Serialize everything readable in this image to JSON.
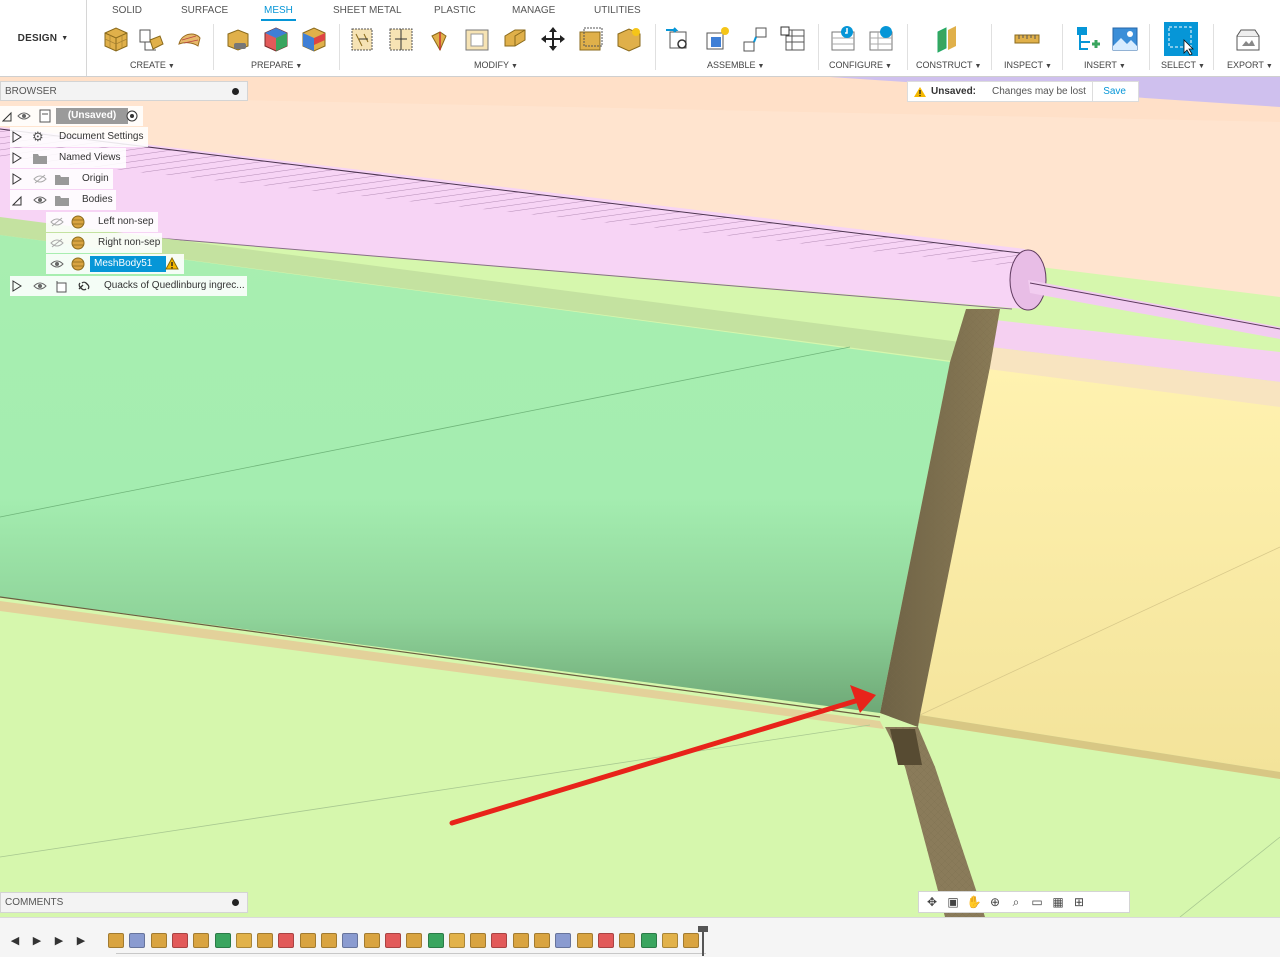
{
  "workspace": {
    "label": "DESIGN"
  },
  "tabs": [
    {
      "label": "SOLID"
    },
    {
      "label": "SURFACE"
    },
    {
      "label": "MESH",
      "active": true
    },
    {
      "label": "SHEET METAL"
    },
    {
      "label": "PLASTIC"
    },
    {
      "label": "MANAGE"
    },
    {
      "label": "UTILITIES"
    }
  ],
  "groups": {
    "create": "CREATE",
    "prepare": "PREPARE",
    "modify": "MODIFY",
    "assemble": "ASSEMBLE",
    "configure": "CONFIGURE",
    "construct": "CONSTRUCT",
    "inspect": "INSPECT",
    "insert": "INSERT",
    "select": "SELECT",
    "export": "EXPORT"
  },
  "browser": {
    "title": "BROWSER",
    "root": "(Unsaved)",
    "items": {
      "document_settings": "Document Settings",
      "named_views": "Named Views",
      "origin": "Origin",
      "bodies": "Bodies",
      "left_body": "Left non-sep",
      "right_body": "Right non-sep",
      "mesh_body": "MeshBody51",
      "linked": "Quacks of Quedlinburg ingrec..."
    }
  },
  "unsaved": {
    "label": "Unsaved:",
    "message": "Changes may be lost",
    "save": "Save"
  },
  "comments": {
    "title": "COMMENTS"
  },
  "colors": {
    "accent": "#0696d7",
    "selected": "#0696d7",
    "annotation_arrow": "#e8231a",
    "warning": "#f5b800"
  },
  "navbar": {
    "icons": [
      "orbit-icon",
      "look-at-icon",
      "pan-icon",
      "zoom-icon",
      "fit-icon",
      "display-settings-icon",
      "grid-icon",
      "viewports-icon"
    ]
  }
}
